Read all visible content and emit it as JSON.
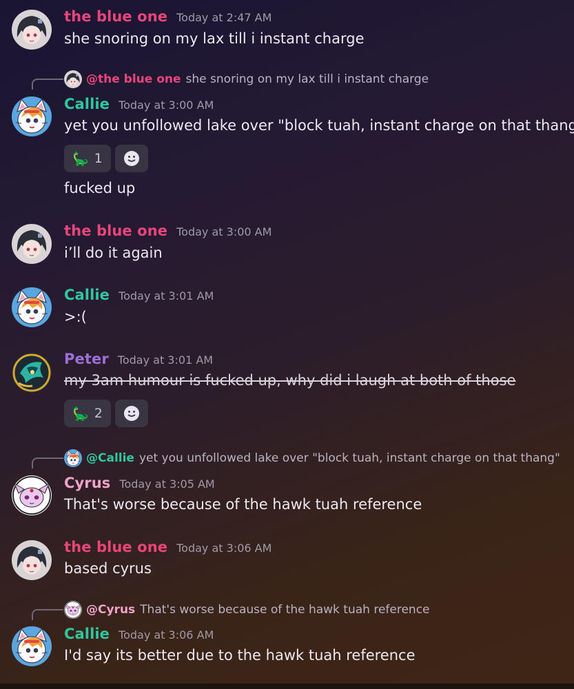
{
  "colors": {
    "blue_one": "#e8457a",
    "callie": "#2fc6a0",
    "peter": "#9b6fd6",
    "cyrus": "#f0a3c9",
    "timestamp": "#a09aa8",
    "reply_text": "#b9b3c2"
  },
  "messages": [
    {
      "author": "the blue one",
      "timestamp": "Today at 2:47 AM",
      "lines": [
        "she snoring on my lax till i instant charge"
      ]
    },
    {
      "reply_to": {
        "mention": "@the blue one",
        "text": "she snoring on my lax till i instant charge"
      },
      "author": "Callie",
      "timestamp": "Today at 3:00 AM",
      "lines": [
        "yet you unfollowed lake over \"block tuah, instant charge on that thang\""
      ],
      "reactions": [
        {
          "icon": "dinosaur-emoji",
          "count": "1"
        }
      ],
      "followup": "fucked up"
    },
    {
      "author": "the blue one",
      "timestamp": "Today at 3:00 AM",
      "lines": [
        "i’ll do it again"
      ]
    },
    {
      "author": "Callie",
      "timestamp": "Today at 3:01 AM",
      "lines": [
        ">:("
      ]
    },
    {
      "author": "Peter",
      "timestamp": "Today at 3:01 AM",
      "lines": [
        "my 3am humour is fucked up, why did i laugh at both of those"
      ],
      "strikethrough": true,
      "reactions": [
        {
          "icon": "dinosaur-emoji",
          "count": "2"
        }
      ]
    },
    {
      "reply_to": {
        "mention": "@Callie",
        "text": "yet you unfollowed lake over \"block tuah, instant charge on that thang\""
      },
      "author": "Cyrus",
      "timestamp": "Today at 3:05 AM",
      "lines": [
        "That's worse because of the hawk tuah reference"
      ]
    },
    {
      "author": "the blue one",
      "timestamp": "Today at 3:06 AM",
      "lines": [
        "based cyrus"
      ]
    },
    {
      "reply_to": {
        "mention": "@Cyrus",
        "text": "That's worse because of the hawk tuah reference"
      },
      "author": "Callie",
      "timestamp": "Today at 3:06 AM",
      "lines": [
        "I'd say its better due to the hawk tuah reference"
      ]
    }
  ]
}
